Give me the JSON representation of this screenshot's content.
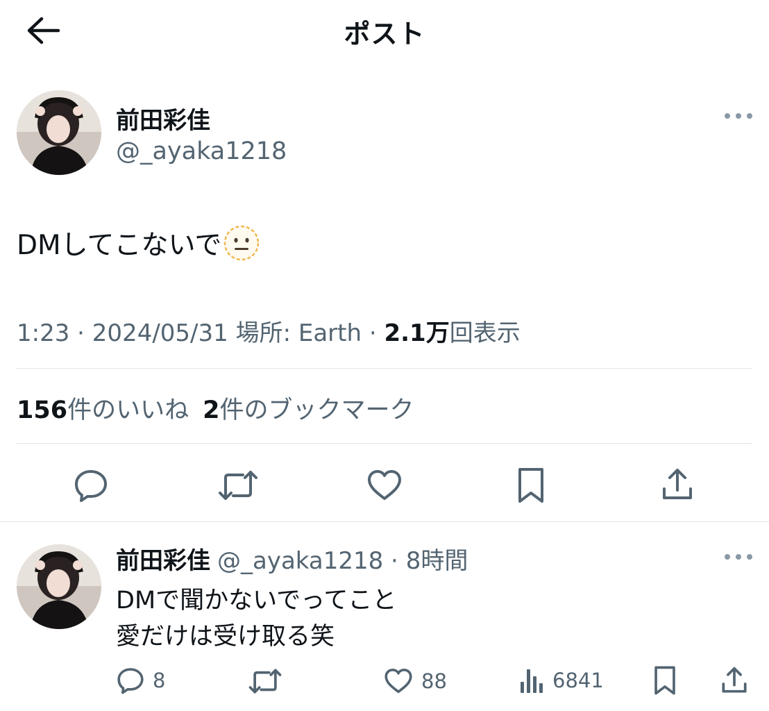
{
  "header": {
    "title": "ポスト"
  },
  "tweet": {
    "author_name": "前田彩佳",
    "author_handle": "@_ayaka1218",
    "text": "DMしてこないで",
    "emoji": "neutral-face",
    "time": "1:23",
    "date": "2024/05/31",
    "location_label": "場所:",
    "location": "Earth",
    "views_count": "2.1万",
    "views_label": "回表示",
    "likes_count": "156",
    "likes_label": "件のいいね",
    "bookmarks_count": "2",
    "bookmarks_label": "件のブックマーク"
  },
  "reply": {
    "author_name": "前田彩佳",
    "author_handle": "@_ayaka1218",
    "time_ago": "8時間",
    "line1": "DMで聞かないでってこと",
    "line2": "愛だけは受け取る笑",
    "reply_count": "8",
    "like_count": "88",
    "view_count": "6841"
  },
  "colors": {
    "text": "#0f1419",
    "secondary": "#536471",
    "divider": "#e1e5e8",
    "icon": "#536471",
    "emoji": "#f5c75a"
  }
}
